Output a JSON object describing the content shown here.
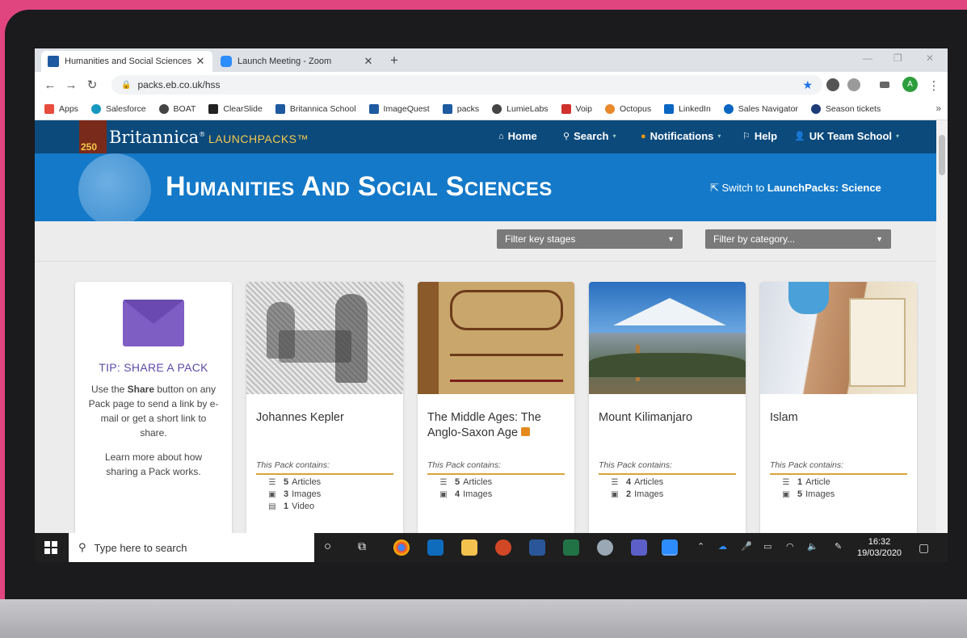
{
  "browser": {
    "tabs": [
      {
        "title": "Humanities and Social Sciences |",
        "close": "✕"
      },
      {
        "title": "Launch Meeting - Zoom",
        "close": "✕"
      }
    ],
    "new_tab": "+",
    "url": "packs.eb.co.uk/hss",
    "avatar_letter": "A",
    "bookmarks": [
      {
        "label": "Apps",
        "color": "#e74c3c"
      },
      {
        "label": "Salesforce",
        "color": "#1798c1"
      },
      {
        "label": "BOAT",
        "color": "#444444"
      },
      {
        "label": "ClearSlide",
        "color": "#222222"
      },
      {
        "label": "Britannica School",
        "color": "#1e5aa0"
      },
      {
        "label": "ImageQuest",
        "color": "#1e5aa0"
      },
      {
        "label": "packs",
        "color": "#1e5aa0"
      },
      {
        "label": "LumieLabs",
        "color": "#444444"
      },
      {
        "label": "Voip",
        "color": "#d0312d"
      },
      {
        "label": "Octopus",
        "color": "#e9892b"
      },
      {
        "label": "LinkedIn",
        "color": "#0a66c2"
      },
      {
        "label": "Sales Navigator",
        "color": "#0a66c2"
      },
      {
        "label": "Season tickets",
        "color": "#1d3c78"
      }
    ],
    "bookmarks_more": "»"
  },
  "site": {
    "logo_number": "250",
    "logo_text": "Britannica",
    "logo_reg": "®",
    "logo_sub": "LAUNCHPACKS™",
    "nav": [
      {
        "label": "Home",
        "icon": "⌂"
      },
      {
        "label": "Search",
        "icon": "⚲"
      },
      {
        "label": "Notifications",
        "icon": "●"
      },
      {
        "label": "Help",
        "icon": "⚐"
      },
      {
        "label": "UK Team School",
        "icon": "👤"
      }
    ],
    "caret": "▾",
    "hero_title": "Humanities And Social Sciences",
    "switch_prefix": "Switch to ",
    "switch_target": "LaunchPacks: Science",
    "filter_stages": "Filter key stages",
    "filter_category": "Filter by category...",
    "dropdown_arrow": "▼"
  },
  "tip": {
    "heading": "TIP: SHARE A PACK",
    "body_pre": "Use the ",
    "body_bold": "Share",
    "body_post": " button on any Pack page to send a link by e-mail or get a short link to share.",
    "more": "Learn more about how sharing a Pack works."
  },
  "packs": [
    {
      "title": "Johannes Kepler",
      "contains": "This Pack contains:",
      "stats": [
        {
          "n": "5",
          "label": "Articles",
          "icon": "☰"
        },
        {
          "n": "3",
          "label": "Images",
          "icon": "▣"
        },
        {
          "n": "1",
          "label": "Video",
          "icon": "▤"
        }
      ]
    },
    {
      "title": "The Middle Ages: The Anglo-Saxon Age",
      "contains": "This Pack contains:",
      "stats": [
        {
          "n": "5",
          "label": "Articles",
          "icon": "☰"
        },
        {
          "n": "4",
          "label": "Images",
          "icon": "▣"
        }
      ]
    },
    {
      "title": "Mount Kilimanjaro",
      "contains": "This Pack contains:",
      "stats": [
        {
          "n": "4",
          "label": "Articles",
          "icon": "☰"
        },
        {
          "n": "2",
          "label": "Images",
          "icon": "▣"
        }
      ]
    },
    {
      "title": "Islam",
      "contains": "This Pack contains:",
      "stats": [
        {
          "n": "1",
          "label": "Article",
          "icon": "☰"
        },
        {
          "n": "5",
          "label": "Images",
          "icon": "▣"
        }
      ]
    }
  ],
  "taskbar": {
    "search_placeholder": "Type here to search",
    "time": "16:32",
    "date": "19/03/2020"
  }
}
